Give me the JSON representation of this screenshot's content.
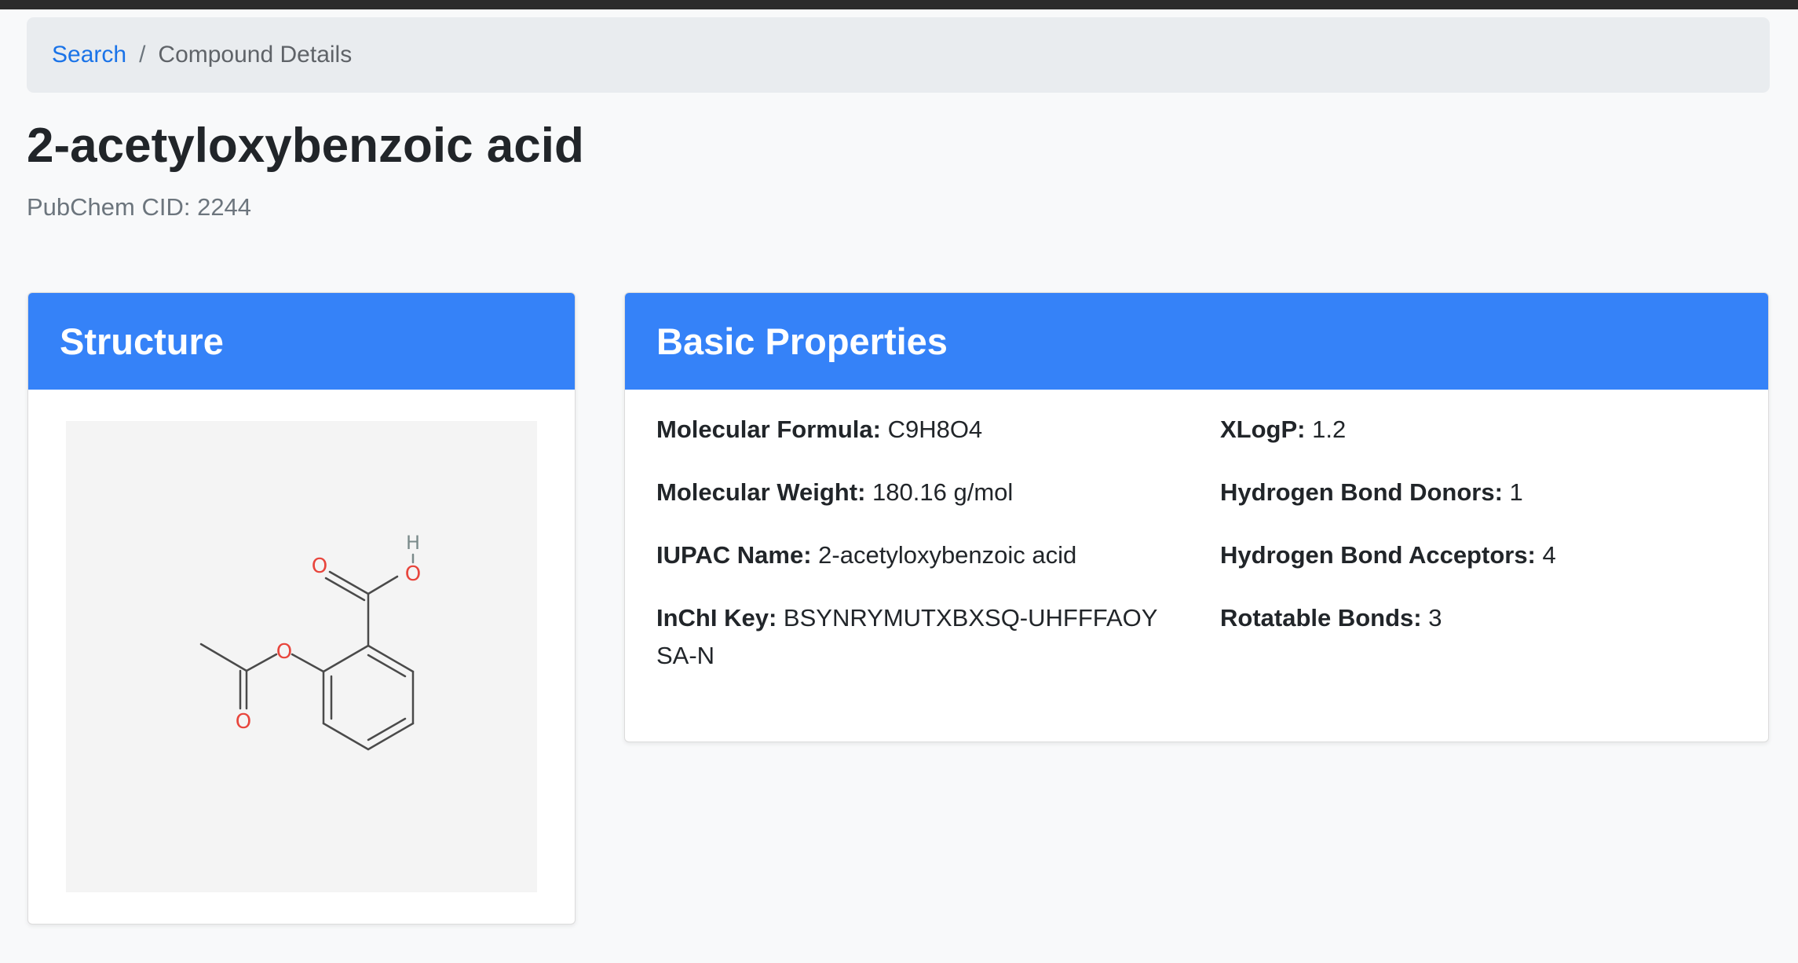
{
  "breadcrumb": {
    "link_label": "Search",
    "separator": "/",
    "current": "Compound Details"
  },
  "compound": {
    "title": "2-acetyloxybenzoic acid",
    "cid_text": "PubChem CID: 2244"
  },
  "structure_card": {
    "header": "Structure",
    "atom_labels": {
      "carbonyl_o": "O",
      "hydroxyl_o": "O",
      "hydroxyl_h": "H",
      "ester_o": "O",
      "acetyl_o": "O"
    },
    "colors": {
      "oxygen": "#e8453c",
      "hydrogen": "#7a8a8a",
      "bond": "#4a4a4a"
    }
  },
  "properties_card": {
    "header": "Basic Properties",
    "left": [
      {
        "label": "Molecular Formula:",
        "value": "C9H8O4"
      },
      {
        "label": "Molecular Weight:",
        "value": "180.16 g/mol"
      },
      {
        "label": "IUPAC Name:",
        "value": "2-acetyloxybenzoic acid"
      },
      {
        "label": "InChI Key:",
        "value": "BSYNRYMUTXBXSQ-UHFFFAOYSA-N"
      }
    ],
    "right": [
      {
        "label": "XLogP:",
        "value": "1.2"
      },
      {
        "label": "Hydrogen Bond Donors:",
        "value": "1"
      },
      {
        "label": "Hydrogen Bond Acceptors:",
        "value": "4"
      },
      {
        "label": "Rotatable Bonds:",
        "value": "3"
      }
    ]
  },
  "theme": {
    "accent": "#3582f8",
    "link": "#1a73e8",
    "page_background": "#f8f9fa",
    "breadcrumb_background": "#e9ecef"
  }
}
